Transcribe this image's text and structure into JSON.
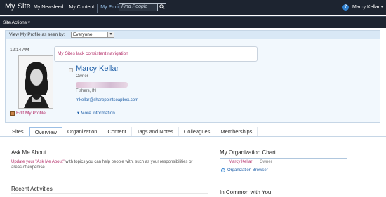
{
  "header": {
    "site_title": "My Site",
    "nav": [
      "My Newsfeed",
      "My Content",
      "My Profile"
    ],
    "search_placeholder": "Find People",
    "user_menu": "Marcy Kellar ▾"
  },
  "actions": {
    "site_actions": "Site Actions ▾"
  },
  "profile": {
    "view_label": "View My Profile as seen by:",
    "view_value": "Everyone",
    "time": "12:14 AM",
    "note": "My Sites lack consistent navigation",
    "name": "Marcy Kellar",
    "role": "Owner",
    "location": "Fishers, IN",
    "email": "mkellar@sharepointsoapbox.com",
    "more_info": "More information",
    "edit_label": "Edit My Profile"
  },
  "tabs": [
    "Sites",
    "Overview",
    "Organization",
    "Content",
    "Tags and Notes",
    "Colleagues",
    "Memberships"
  ],
  "selected_tab": "Overview",
  "ask_me": {
    "heading": "Ask Me About",
    "link": "Update your \"Ask Me About\"",
    "text": " with topics you can help people with, such as your responsibilities or areas of expertise."
  },
  "recent": {
    "heading": "Recent Activities"
  },
  "org_chart": {
    "heading": "My Organization Chart",
    "name": "Marcy Kellar",
    "role": "Owner",
    "browser": "Organization Browser"
  },
  "in_common": {
    "heading": "In Common with You"
  }
}
